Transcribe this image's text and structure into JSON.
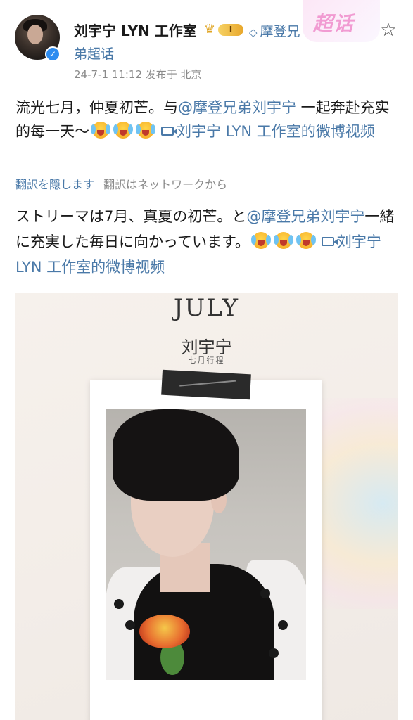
{
  "header": {
    "account_name": "刘宇宁 LYN 工作室",
    "vip_level": "I",
    "topic_link_part1": "摩登兄",
    "topic_link_part2": "弟超话",
    "chaohua_badge": "超话",
    "meta": "24-7-1 11:12  发布于 北京"
  },
  "post": {
    "line1_prefix": "流光七月，仲夏初芒。与",
    "mention": "@摩登兄弟刘宇宁",
    "line1_suffix": " 一起奔赴充实的每一天～",
    "video_link": "刘宇宁 LYN 工作室的微博视频"
  },
  "translation": {
    "hide_label": "翻訳を隠します",
    "source_label": "翻訳はネットワークから",
    "text_prefix": "ストリーマは7月、真夏の初芒。と",
    "mention": "@摩登兄弟刘宇宁",
    "text_middle": "一緒に充実した毎日に向かっています。",
    "video_link": "刘宇宁 LYN 工作室的微博视频"
  },
  "image": {
    "title": "JULY",
    "name": "刘宇宁",
    "subtitle": "七月行程"
  },
  "icons": {
    "verified": "verified-check-icon",
    "star": "star-outline-icon",
    "video": "video-icon",
    "emoji": "crying-laughing-emoji"
  },
  "colors": {
    "link": "#4a79a8",
    "meta": "#8a8a8a",
    "chaohua": "#f19bd2",
    "verified": "#2d8cf0"
  }
}
